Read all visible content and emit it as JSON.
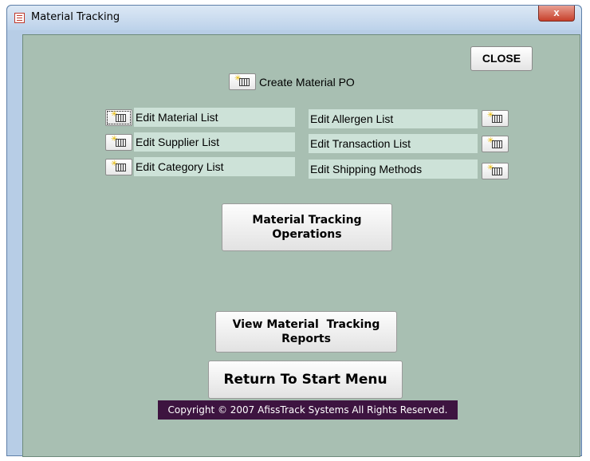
{
  "window": {
    "title": "Material Tracking",
    "close_glyph": "x",
    "icon": "form-icon"
  },
  "buttons": {
    "close": "CLOSE",
    "create_po": "Create Material PO",
    "operations_line1": "Material Tracking",
    "operations_line2": "Operations",
    "reports_line1": "View Material  Tracking",
    "reports_line2": "Reports",
    "return": "Return To Start Menu"
  },
  "left_items": [
    {
      "label": "Edit Material List",
      "icon": "new-table-icon"
    },
    {
      "label": "Edit Supplier List",
      "icon": "new-table-icon"
    },
    {
      "label": "Edit Category List",
      "icon": "new-table-icon"
    }
  ],
  "right_items": [
    {
      "label": "Edit Allergen List",
      "icon": "new-table-icon"
    },
    {
      "label": "Edit Transaction List",
      "icon": "new-table-icon"
    },
    {
      "label": "Edit Shipping Methods",
      "icon": "new-table-icon"
    }
  ],
  "footer": {
    "copyright": "Copyright © 2007 AfissTrack Systems All Rights Reserved."
  },
  "colors": {
    "form_background": "#a8bfb2",
    "label_panel": "#cde2d8",
    "copyright_background": "#3d1440",
    "title_close": "#c7402b"
  }
}
